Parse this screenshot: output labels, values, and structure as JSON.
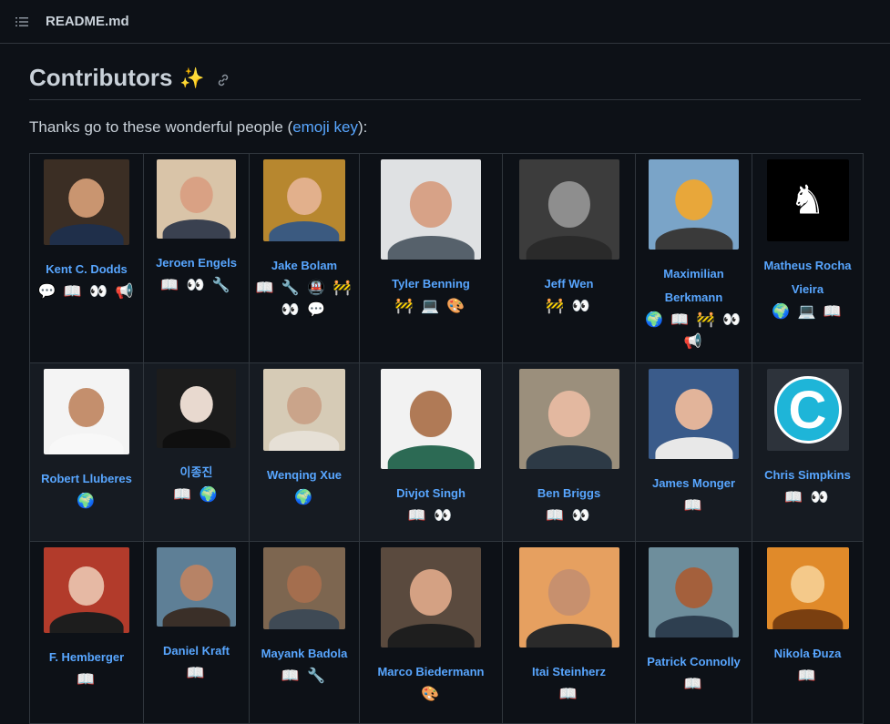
{
  "header": {
    "filename": "README.md",
    "icon": "list-icon"
  },
  "heading": {
    "title": "Contributors",
    "emoji": "✨",
    "icon": "link-icon"
  },
  "intro": {
    "text_before": "Thanks go to these wonderful people (",
    "link": "emoji key",
    "text_after": "):"
  },
  "rows": [
    [
      {
        "name": "Kent C. Dodds",
        "contribs": "💬 📖 👀 📢",
        "bg": "#3b2e24",
        "skin": "#c99570",
        "shirt": "#1f2f4a",
        "w": 94,
        "h": 94
      },
      {
        "name": "Jeroen Engels",
        "contribs": "📖 👀 🔧",
        "bg": "#d9c4a8",
        "skin": "#d9a184",
        "shirt": "#3a4150",
        "w": 87,
        "h": 87
      },
      {
        "name": "Jake Bolam",
        "contribs": "📖 🔧 🚇 🚧 👀 💬",
        "bg": "#b7872f",
        "skin": "#e2b08c",
        "shirt": "#3b5a80",
        "w": 90,
        "h": 90
      },
      {
        "name": "Tyler Benning",
        "contribs": "🚧 💻 🎨",
        "bg": "#dfe1e3",
        "skin": "#d7a287",
        "shirt": "#56616b",
        "w": 110,
        "h": 110
      },
      {
        "name": "Jeff Wen",
        "contribs": "🚧 👀",
        "bg": "#3c3c3c",
        "skin": "#8e8e8e",
        "shirt": "#2a2a2a",
        "w": 110,
        "h": 110
      },
      {
        "name": "Maximilian Berkmann",
        "contribs": "🌍 📖 🚧 👀 📢",
        "bg": "#7aa4c8",
        "skin": "#e8a73a",
        "shirt": "#3a3a3a",
        "w": 99,
        "h": 99
      },
      {
        "name": "Matheus Rocha Vieira",
        "contribs": "🌍 💻 📖",
        "bg": "#000000",
        "skin": "#000000",
        "shirt": "#000000",
        "w": 90,
        "h": 90,
        "special": "mask"
      }
    ],
    [
      {
        "name": "Robert Lluberes",
        "contribs": "🌍",
        "bg": "#f4f4f4",
        "skin": "#c48f6d",
        "shirt": "#f8f8f8",
        "w": 94,
        "h": 94
      },
      {
        "name": "이종진",
        "contribs": "📖 🌍",
        "bg": "#1c1c1c",
        "skin": "#e8d9cf",
        "shirt": "#0f0f0f",
        "w": 87,
        "h": 87
      },
      {
        "name": "Wenqing Xue",
        "contribs": "🌍",
        "bg": "#d6cbb6",
        "skin": "#caa48a",
        "shirt": "#e6e0d6",
        "w": 90,
        "h": 90
      },
      {
        "name": "Divjot Singh",
        "contribs": "📖 👀",
        "bg": "#f2f2f2",
        "skin": "#b07a56",
        "shirt": "#2c6a54",
        "w": 110,
        "h": 110
      },
      {
        "name": "Ben Briggs",
        "contribs": "📖 👀",
        "bg": "#9b8f7c",
        "skin": "#e3b8a0",
        "shirt": "#2d3a46",
        "w": 110,
        "h": 110
      },
      {
        "name": "James Monger",
        "contribs": "📖",
        "bg": "#3a5b8a",
        "skin": "#e2b49a",
        "shirt": "#e8e8e8",
        "w": 99,
        "h": 99
      },
      {
        "name": "Chris Simpkins",
        "contribs": "📖 👀",
        "bg": "#2d333b",
        "skin": "#1eb5d8",
        "shirt": "#2d333b",
        "w": 90,
        "h": 90,
        "special": "logo"
      }
    ],
    [
      {
        "name": "F. Hemberger",
        "contribs": "📖",
        "bg": "#b23b2b",
        "skin": "#e6b9a4",
        "shirt": "#1d1d1d",
        "w": 94,
        "h": 94
      },
      {
        "name": "Daniel Kraft",
        "contribs": "📖",
        "bg": "#5e7f96",
        "skin": "#b78366",
        "shirt": "#3a2f28",
        "w": 87,
        "h": 87
      },
      {
        "name": "Mayank Badola",
        "contribs": "📖 🔧",
        "bg": "#7d6650",
        "skin": "#a46e4e",
        "shirt": "#3f4a55",
        "w": 90,
        "h": 90
      },
      {
        "name": "Marco Biedermann",
        "contribs": "🎨",
        "bg": "#5a4a3e",
        "skin": "#d4a183",
        "shirt": "#1e1e1e",
        "w": 110,
        "h": 110
      },
      {
        "name": "Itai Steinherz",
        "contribs": "📖",
        "bg": "#e6a060",
        "skin": "#c7906e",
        "shirt": "#2a2a2a",
        "w": 110,
        "h": 110
      },
      {
        "name": "Patrick Connolly",
        "contribs": "📖",
        "bg": "#6e8e9c",
        "skin": "#a4603c",
        "shirt": "#2e3f50",
        "w": 99,
        "h": 99
      },
      {
        "name": "Nikola Đuza",
        "contribs": "📖",
        "bg": "#e08a2a",
        "skin": "#f4c98a",
        "shirt": "#7a3f10",
        "w": 90,
        "h": 90
      }
    ]
  ]
}
